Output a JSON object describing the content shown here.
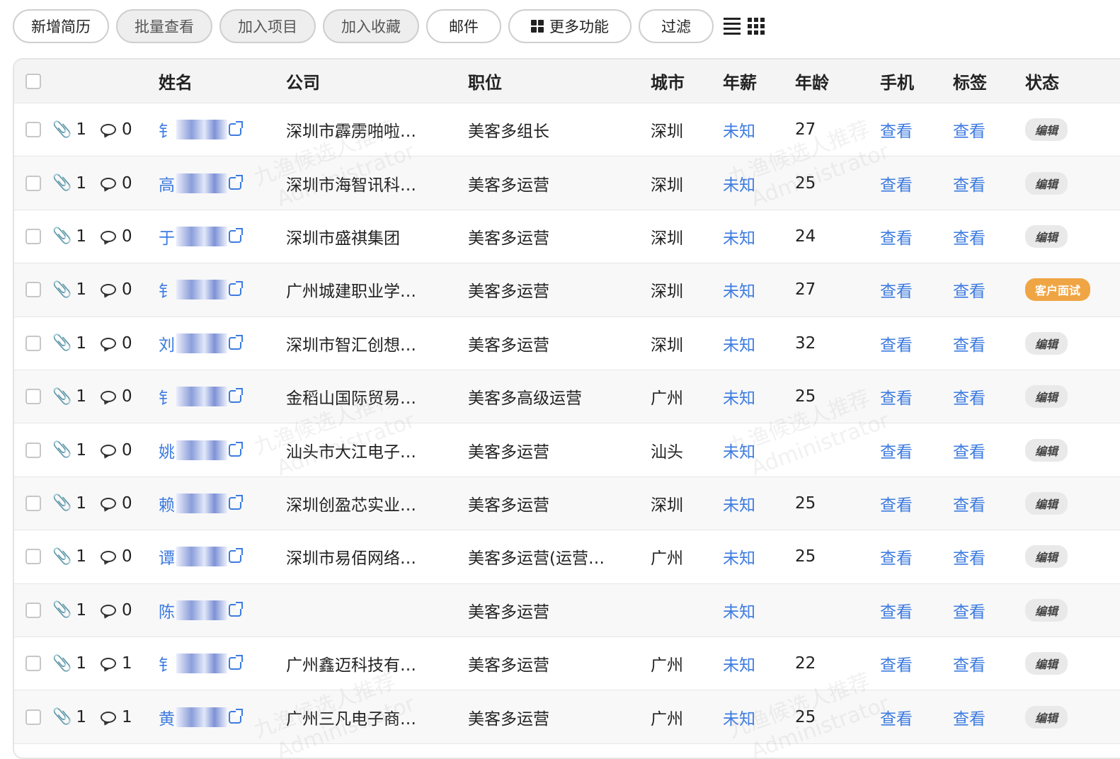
{
  "toolbar": {
    "buttons": [
      {
        "label": "新增简历",
        "disabled": false
      },
      {
        "label": "批量查看",
        "disabled": true
      },
      {
        "label": "加入项目",
        "disabled": true
      },
      {
        "label": "加入收藏",
        "disabled": true
      },
      {
        "label": "邮件",
        "disabled": false
      },
      {
        "label": "更多功能",
        "disabled": false
      },
      {
        "label": "过滤",
        "disabled": false
      }
    ]
  },
  "table": {
    "columns": [
      "姓名",
      "公司",
      "职位",
      "城市",
      "年薪",
      "年龄",
      "手机",
      "标签",
      "状态"
    ],
    "rows": [
      {
        "attach": "1",
        "comments": "0",
        "name": "钅",
        "company": "深圳市霹雳啪啦…",
        "position": "美客多组长",
        "city": "深圳",
        "salary": "未知",
        "age": "27",
        "phone": "查看",
        "tags": "查看",
        "status": "编辑"
      },
      {
        "attach": "1",
        "comments": "0",
        "name": "高",
        "company": "深圳市海智讯科…",
        "position": "美客多运营",
        "city": "深圳",
        "salary": "未知",
        "age": "25",
        "phone": "查看",
        "tags": "查看",
        "status": "编辑"
      },
      {
        "attach": "1",
        "comments": "0",
        "name": "于",
        "company": "深圳市盛祺集团",
        "position": "美客多运营",
        "city": "深圳",
        "salary": "未知",
        "age": "24",
        "phone": "查看",
        "tags": "查看",
        "status": "编辑"
      },
      {
        "attach": "1",
        "comments": "0",
        "name": "钅",
        "company": "广州城建职业学…",
        "position": "美客多运营",
        "city": "深圳",
        "salary": "未知",
        "age": "27",
        "phone": "查看",
        "tags": "查看",
        "status": "客户面试"
      },
      {
        "attach": "1",
        "comments": "0",
        "name": "刘",
        "company": "深圳市智汇创想…",
        "position": "美客多运营",
        "city": "深圳",
        "salary": "未知",
        "age": "32",
        "phone": "查看",
        "tags": "查看",
        "status": "编辑"
      },
      {
        "attach": "1",
        "comments": "0",
        "name": "钅",
        "company": "金稻山国际贸易…",
        "position": "美客多高级运营",
        "city": "广州",
        "salary": "未知",
        "age": "25",
        "phone": "查看",
        "tags": "查看",
        "status": "编辑"
      },
      {
        "attach": "1",
        "comments": "0",
        "name": "姚",
        "company": "汕头市大江电子…",
        "position": "美客多运营",
        "city": "汕头",
        "salary": "未知",
        "age": "",
        "phone": "查看",
        "tags": "查看",
        "status": "编辑"
      },
      {
        "attach": "1",
        "comments": "0",
        "name": "赖",
        "company": "深圳创盈芯实业…",
        "position": "美客多运营",
        "city": "深圳",
        "salary": "未知",
        "age": "25",
        "phone": "查看",
        "tags": "查看",
        "status": "编辑"
      },
      {
        "attach": "1",
        "comments": "0",
        "name": "谭",
        "company": "深圳市易佰网络…",
        "position": "美客多运营(运营…",
        "city": "广州",
        "salary": "未知",
        "age": "25",
        "phone": "查看",
        "tags": "查看",
        "status": "编辑"
      },
      {
        "attach": "1",
        "comments": "0",
        "name": "陈",
        "company": "",
        "position": "美客多运营",
        "city": "",
        "salary": "未知",
        "age": "",
        "phone": "查看",
        "tags": "查看",
        "status": "编辑"
      },
      {
        "attach": "1",
        "comments": "1",
        "name": "钅",
        "company": "广州鑫迈科技有…",
        "position": "美客多运营",
        "city": "广州",
        "salary": "未知",
        "age": "22",
        "phone": "查看",
        "tags": "查看",
        "status": "编辑"
      },
      {
        "attach": "1",
        "comments": "1",
        "name": "黄",
        "company": "广州三凡电子商…",
        "position": "美客多运营",
        "city": "广州",
        "salary": "未知",
        "age": "25",
        "phone": "查看",
        "tags": "查看",
        "status": "编辑"
      }
    ]
  },
  "watermark": {
    "line1": "九渔候选人推荐",
    "line2": "Administrator"
  },
  "colors": {
    "link": "#3d7be0",
    "status_orange": "#f0a544"
  }
}
